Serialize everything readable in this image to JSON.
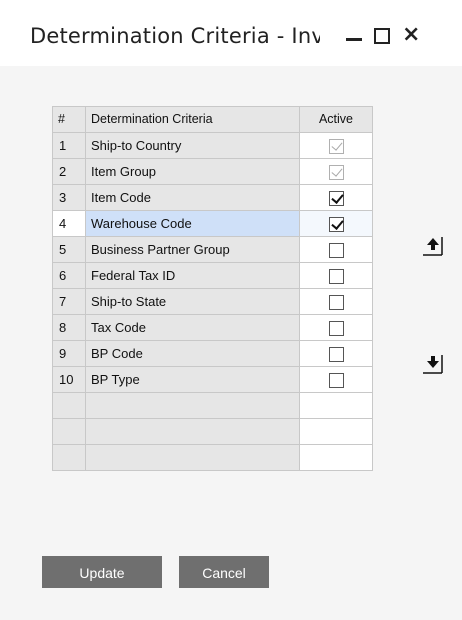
{
  "window": {
    "title": "Determination Criteria - Inv"
  },
  "table": {
    "headers": {
      "num": "#",
      "criteria": "Determination Criteria",
      "active": "Active"
    },
    "rows": [
      {
        "num": "1",
        "criteria": "Ship-to Country",
        "active": true,
        "disabled": true
      },
      {
        "num": "2",
        "criteria": "Item Group",
        "active": true,
        "disabled": true
      },
      {
        "num": "3",
        "criteria": "Item Code",
        "active": true,
        "disabled": false
      },
      {
        "num": "4",
        "criteria": "Warehouse Code",
        "active": true,
        "disabled": false,
        "selected": true
      },
      {
        "num": "5",
        "criteria": "Business Partner Group",
        "active": false,
        "disabled": false
      },
      {
        "num": "6",
        "criteria": "Federal Tax ID",
        "active": false,
        "disabled": false
      },
      {
        "num": "7",
        "criteria": "Ship-to State",
        "active": false,
        "disabled": false
      },
      {
        "num": "8",
        "criteria": "Tax Code",
        "active": false,
        "disabled": false
      },
      {
        "num": "9",
        "criteria": "BP Code",
        "active": false,
        "disabled": false
      },
      {
        "num": "10",
        "criteria": "BP Type",
        "active": false,
        "disabled": false
      }
    ]
  },
  "buttons": {
    "update": "Update",
    "cancel": "Cancel"
  },
  "icons": {
    "minimize": "minimize-icon",
    "maximize": "maximize-icon",
    "close": "close-icon",
    "move_up": "arrow-up-icon",
    "move_down": "arrow-down-icon"
  }
}
